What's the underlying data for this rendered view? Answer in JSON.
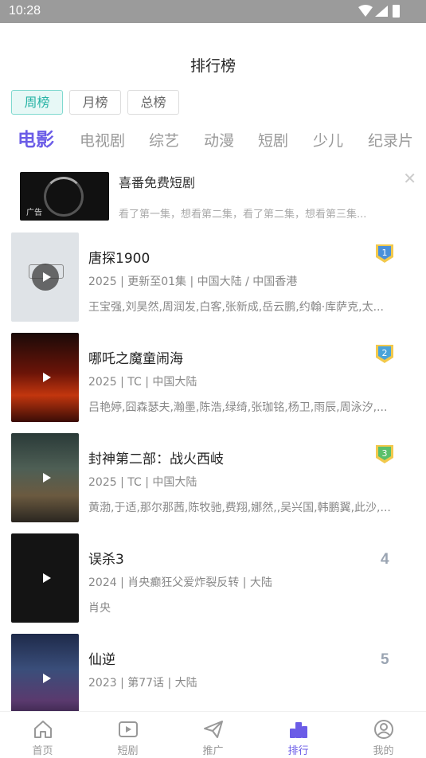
{
  "status": {
    "time": "10:28"
  },
  "page": {
    "title": "排行榜"
  },
  "periods": [
    {
      "label": "周榜",
      "active": true
    },
    {
      "label": "月榜",
      "active": false
    },
    {
      "label": "总榜",
      "active": false
    }
  ],
  "categories": [
    {
      "label": "电影",
      "active": true
    },
    {
      "label": "电视剧",
      "active": false
    },
    {
      "label": "综艺",
      "active": false
    },
    {
      "label": "动漫",
      "active": false
    },
    {
      "label": "短剧",
      "active": false
    },
    {
      "label": "少儿",
      "active": false
    },
    {
      "label": "纪录片",
      "active": false
    }
  ],
  "ad": {
    "title": "喜番免费短剧",
    "description": "看了第一集，想看第二集，看了第二集，想看第三集...",
    "tag": "广告"
  },
  "items": [
    {
      "rank": "1",
      "title": "唐探1900",
      "meta": "2025 | 更新至01集 | 中国大陆 / 中国香港",
      "cast": "王宝强,刘昊然,周润发,白客,张新成,岳云鹏,约翰·库萨克,太...",
      "badge_color": "#4a90d9"
    },
    {
      "rank": "2",
      "title": "哪吒之魔童闹海",
      "meta": "2025 | TC | 中国大陆",
      "cast": "吕艳婷,囧森瑟夫,瀚墨,陈浩,绿绮,张珈铭,杨卫,雨辰,周泳汐,...",
      "badge_color": "#4aa3d9"
    },
    {
      "rank": "3",
      "title": "封神第二部：战火西岐",
      "meta": "2025 | TC | 中国大陆",
      "cast": "黄渤,于适,那尔那茜,陈牧驰,费翔,娜然,,吴兴国,韩鹏翼,此沙,...",
      "badge_color": "#5bbf6a"
    },
    {
      "rank": "4",
      "title": "误杀3",
      "meta": "2024 | 肖央癫狂父爱炸裂反转 | 大陆",
      "cast": "肖央"
    },
    {
      "rank": "5",
      "title": "仙逆",
      "meta": "2023 | 第77话 | 大陆",
      "cast": ""
    }
  ],
  "nav": [
    {
      "label": "首页",
      "icon": "home-icon",
      "active": false
    },
    {
      "label": "短剧",
      "icon": "video-icon",
      "active": false
    },
    {
      "label": "推广",
      "icon": "send-icon",
      "active": false
    },
    {
      "label": "排行",
      "icon": "ranking-icon",
      "active": true
    },
    {
      "label": "我的",
      "icon": "profile-icon",
      "active": false
    }
  ],
  "colors": {
    "accent": "#6b5ce7",
    "teal": "#27b3a5"
  }
}
